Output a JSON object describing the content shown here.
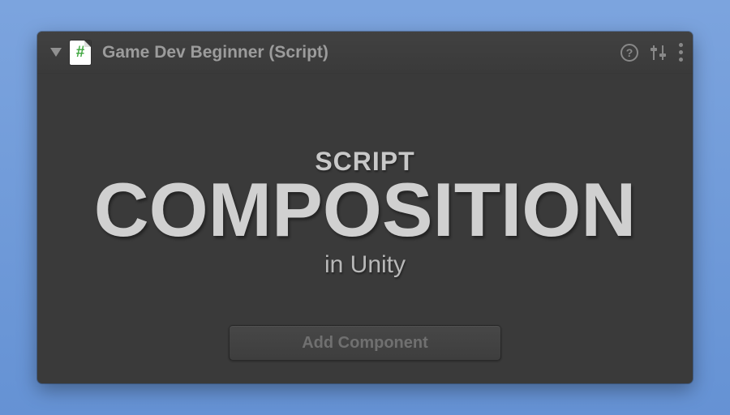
{
  "header": {
    "icon_symbol": "#",
    "title": "Game Dev Beginner (Script)",
    "help_symbol": "?"
  },
  "hero": {
    "line1": "SCRIPT",
    "line2": "COMPOSITION",
    "line3": "in Unity"
  },
  "footer": {
    "add_component_label": "Add Component"
  },
  "colors": {
    "panel_bg": "#3a3a3a",
    "text_muted": "#9c9c9c",
    "hero_text": "#d0d0d0",
    "bg_gradient_start": "#7ca4de",
    "bg_gradient_end": "#6592d4"
  }
}
